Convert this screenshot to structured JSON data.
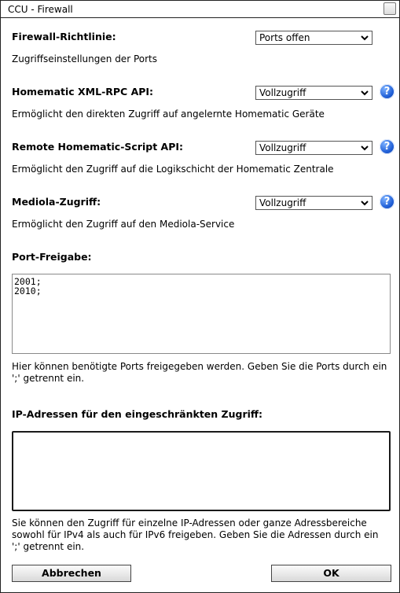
{
  "window": {
    "title": "CCU - Firewall"
  },
  "sections": {
    "firewall_policy": {
      "label": "Firewall-Richtlinie:",
      "selected": "Ports offen",
      "description": "Zugriffseinstellungen der Ports"
    },
    "xmlrpc": {
      "label": "Homematic XML-RPC API:",
      "selected": "Vollzugriff",
      "description": "Ermöglicht den direkten Zugriff auf angelernte Homematic Geräte",
      "help": "?"
    },
    "script_api": {
      "label": "Remote Homematic-Script API:",
      "selected": "Vollzugriff",
      "description": "Ermöglicht den Zugriff auf die Logikschicht der Homematic Zentrale",
      "help": "?"
    },
    "mediola": {
      "label": "Mediola-Zugriff:",
      "selected": "Vollzugriff",
      "description": "Ermöglicht den Zugriff auf den Mediola-Service",
      "help": "?"
    },
    "port_release": {
      "label": "Port-Freigabe:",
      "value": "2001;\n2010;",
      "description": "Hier können benötigte Ports freigegeben werden. Geben Sie die Ports durch ein ';' getrennt ein."
    },
    "ip_restricted": {
      "label": "IP-Adressen für den eingeschränkten Zugriff:",
      "value": "",
      "description": "Sie können den Zugriff für einzelne IP-Adressen oder ganze Adressbereiche sowohl für IPv4 als auch für IPv6 freigeben. Geben Sie die Adressen durch ein ';' getrennt ein."
    }
  },
  "buttons": {
    "cancel": "Abbrechen",
    "ok": "OK"
  },
  "icons": {
    "close": "close-icon",
    "help": "help-icon",
    "dropdown": "chevron-down-icon"
  },
  "colors": {
    "help_icon": "#1f5ed6",
    "border": "#222222"
  }
}
